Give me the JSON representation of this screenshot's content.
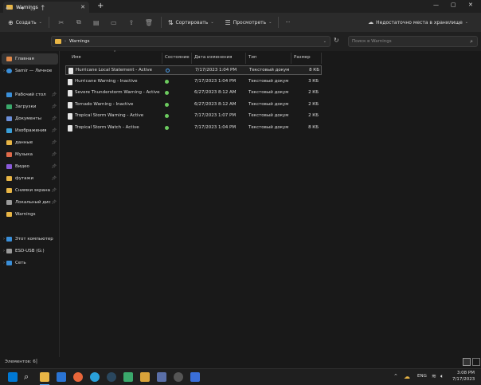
{
  "window": {
    "tab_title": "Warnings",
    "new_tab_label": "+",
    "close_tab_label": "✕"
  },
  "toolbar": {
    "create_label": "Создать",
    "sort_label": "Сортировать",
    "view_label": "Просмотреть",
    "more_label": "···",
    "storage_label": "Недостаточно места в хранилище"
  },
  "address": {
    "path": "Warnings",
    "search_placeholder": "Поиск в Warnings"
  },
  "sidebar": {
    "items": [
      {
        "label": "Главная"
      },
      {
        "label": "Samir — Личное"
      },
      {
        "label": "Рабочий стол"
      },
      {
        "label": "Загрузки"
      },
      {
        "label": "Документы"
      },
      {
        "label": "Изображения"
      },
      {
        "label": "данные"
      },
      {
        "label": "Музыка"
      },
      {
        "label": "Видео"
      },
      {
        "label": "футажи"
      },
      {
        "label": "Снимки экрана"
      },
      {
        "label": "Локальный дис"
      },
      {
        "label": "Warnings"
      },
      {
        "label": "Этот компьютер"
      },
      {
        "label": "ESD-USB (G:)"
      },
      {
        "label": "Сеть"
      }
    ]
  },
  "columns": {
    "name": "Имя",
    "status": "Состояние",
    "date": "Дата изменения",
    "type": "Тип",
    "size": "Размер"
  },
  "files": [
    {
      "name": "Hurricane Local Statement - Active",
      "status": "sync",
      "date": "7/17/2023 1:04 PM",
      "type": "Текстовый докум...",
      "size": "8 КБ"
    },
    {
      "name": "Hurricane Warning - Inactive",
      "status": "ok",
      "date": "7/17/2023 1:04 PM",
      "type": "Текстовый докум...",
      "size": "3 КБ"
    },
    {
      "name": "Severe Thunderstorm Warning - Active",
      "status": "ok",
      "date": "6/27/2023 8:12 AM",
      "type": "Текстовый докум...",
      "size": "2 КБ"
    },
    {
      "name": "Tornado Warning - Inactive",
      "status": "ok",
      "date": "6/27/2023 8:12 AM",
      "type": "Текстовый докум...",
      "size": "2 КБ"
    },
    {
      "name": "Tropical Storm Warning - Active",
      "status": "ok",
      "date": "7/17/2023 1:07 PM",
      "type": "Текстовый докум...",
      "size": "2 КБ"
    },
    {
      "name": "Tropical Storm Watch - Active",
      "status": "ok",
      "date": "7/17/2023 1:04 PM",
      "type": "Текстовый докум...",
      "size": "8 КБ"
    }
  ],
  "statusbar": {
    "count_text": "Элементов: 6"
  },
  "taskbar": {
    "lang": "ENG",
    "time": "3:08 PM",
    "date": "7/17/2023"
  },
  "colors": {
    "accent": "#0078d4",
    "folder": "#e8b545",
    "status_ok": "#6ccb5f",
    "status_sync": "#4aa0f0"
  }
}
